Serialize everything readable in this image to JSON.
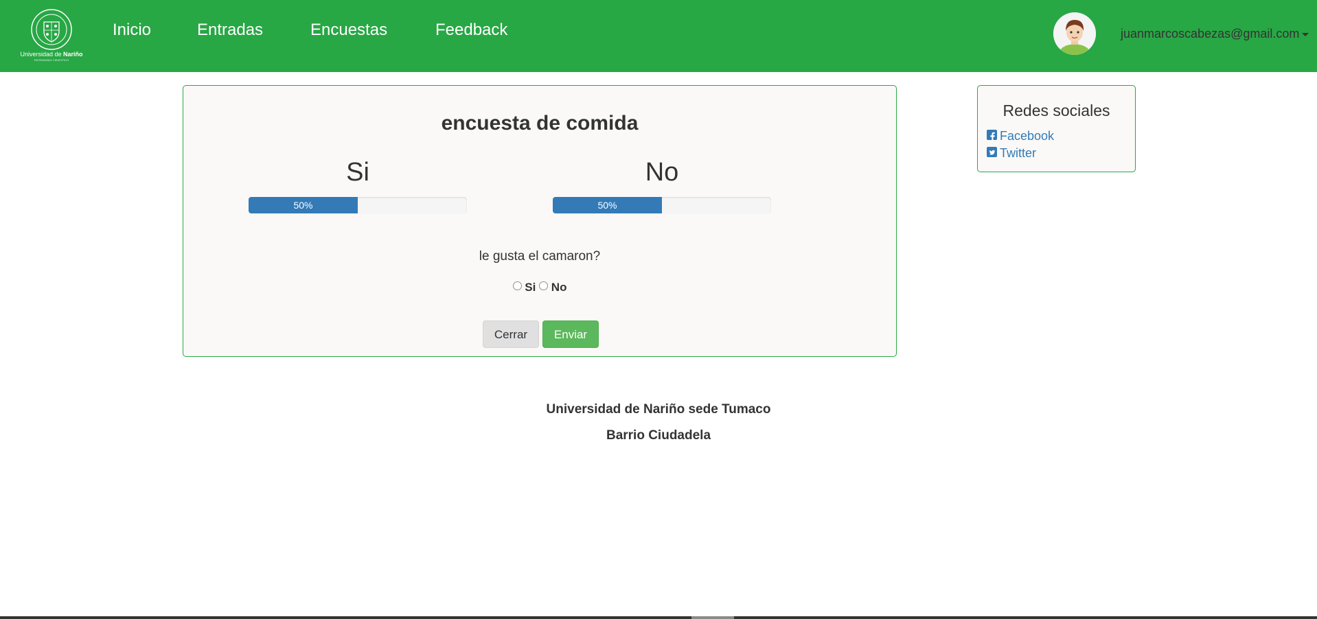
{
  "logo": {
    "name_prefix": "Universidad de ",
    "name_bold": "Nariño",
    "subtitle": "PATRIMONIO CIENTIFICO"
  },
  "nav": {
    "items": [
      "Inicio",
      "Entradas",
      "Encuestas",
      "Feedback"
    ]
  },
  "user": {
    "email": "juanmarcoscabezas@gmail.com"
  },
  "survey": {
    "title": "encuesta de comida",
    "options": [
      {
        "label": "Si",
        "percent": 50,
        "percent_text": "50%"
      },
      {
        "label": "No",
        "percent": 50,
        "percent_text": "50%"
      }
    ],
    "question": "le gusta el camaron?",
    "radio_labels": [
      "Si",
      "No"
    ],
    "close_label": "Cerrar",
    "send_label": "Enviar"
  },
  "social": {
    "title": "Redes sociales",
    "links": [
      {
        "label": "Facebook",
        "icon": "facebook-square-icon"
      },
      {
        "label": "Twitter",
        "icon": "twitter-square-icon"
      }
    ]
  },
  "footer": {
    "line1": "Universidad de Nariño sede Tumaco",
    "line2": "Barrio Ciudadela"
  },
  "colors": {
    "navbar": "#28a745",
    "progress": "#337ab7",
    "link": "#337ab7",
    "send_button": "#5cb85c",
    "panel_border": "#28a745"
  }
}
